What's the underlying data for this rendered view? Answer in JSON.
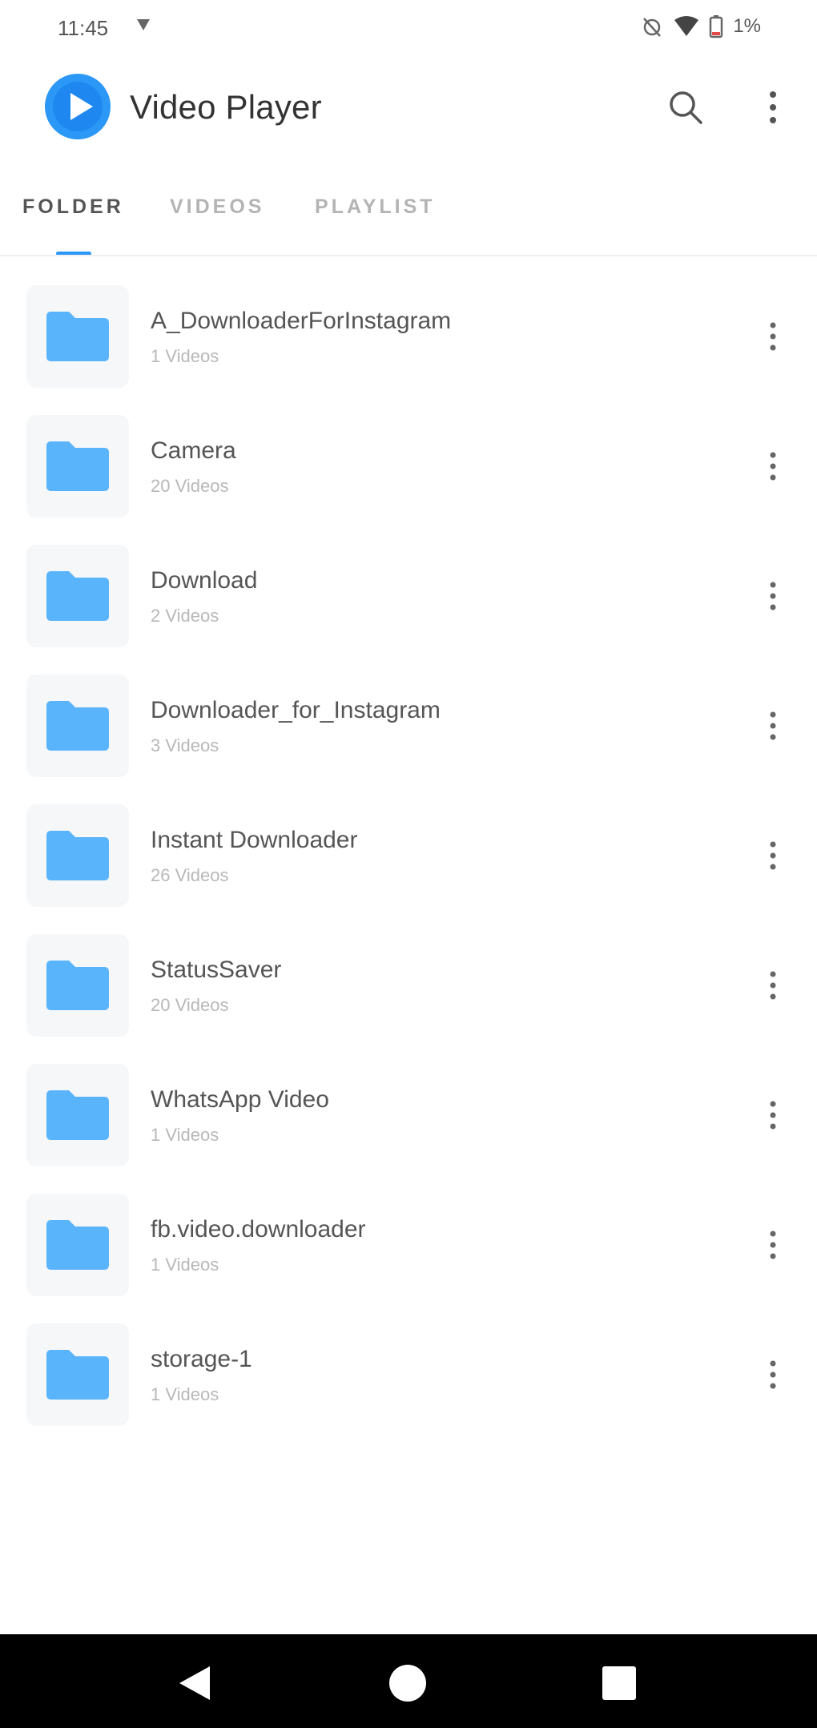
{
  "status_bar": {
    "time": "11:45",
    "battery": "1%"
  },
  "app_bar": {
    "title": "Video Player",
    "icons": [
      "play-logo-icon",
      "search-icon",
      "more-vert-icon"
    ]
  },
  "tabs": [
    {
      "label": "FOLDER",
      "active": true
    },
    {
      "label": "VIDEOS",
      "active": false
    },
    {
      "label": "PLAYLIST",
      "active": false
    }
  ],
  "colors": {
    "accent": "#2b97f6",
    "folder": "#5ab4fb"
  },
  "folders": [
    {
      "name": "A_DownloaderForInstagram",
      "count": "1 Videos"
    },
    {
      "name": "Camera",
      "count": "20 Videos"
    },
    {
      "name": "Download",
      "count": "2 Videos"
    },
    {
      "name": "Downloader_for_Instagram",
      "count": "3 Videos"
    },
    {
      "name": "Instant Downloader",
      "count": "26 Videos"
    },
    {
      "name": "StatusSaver",
      "count": "20 Videos"
    },
    {
      "name": "WhatsApp Video",
      "count": "1 Videos"
    },
    {
      "name": "fb.video.downloader",
      "count": "1 Videos"
    },
    {
      "name": "storage-1",
      "count": "1 Videos"
    }
  ]
}
